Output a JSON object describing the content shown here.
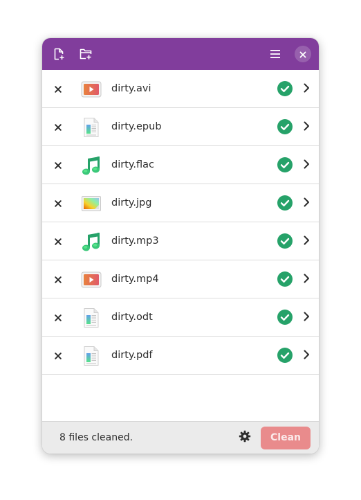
{
  "headerbar": {
    "background": "#813d9c",
    "add_files_icon": "document-new-icon",
    "add_folder_icon": "folder-new-icon",
    "menu_icon": "hamburger-menu-icon",
    "close_icon": "close-icon"
  },
  "files": [
    {
      "name": "dirty.avi",
      "type": "video"
    },
    {
      "name": "dirty.epub",
      "type": "document"
    },
    {
      "name": "dirty.flac",
      "type": "audio"
    },
    {
      "name": "dirty.jpg",
      "type": "image"
    },
    {
      "name": "dirty.mp3",
      "type": "audio"
    },
    {
      "name": "dirty.mp4",
      "type": "video"
    },
    {
      "name": "dirty.odt",
      "type": "document"
    },
    {
      "name": "dirty.pdf",
      "type": "document"
    }
  ],
  "row_status": "cleaned",
  "colors": {
    "success": "#26a269",
    "destructive_disabled": "#e98b8c"
  },
  "footer": {
    "status": "8 files cleaned.",
    "settings_icon": "gear-icon",
    "clean_label": "Clean"
  }
}
